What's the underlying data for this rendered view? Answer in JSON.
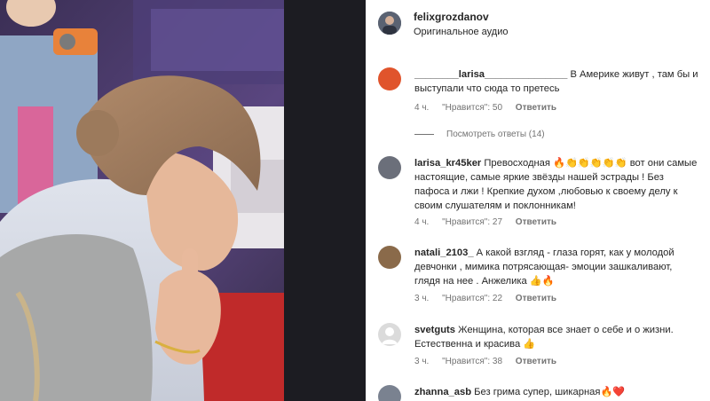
{
  "post": {
    "username": "felixgrozdanov",
    "audio": "Оригинальное аудио"
  },
  "comments": [
    {
      "username": "________larisa_______________",
      "text": "В Америке живут , там бы и выступали что сюда то претесь",
      "time": "4 ч.",
      "likes": "\"Нравится\": 50",
      "reply": "Ответить",
      "avatar_color": "#e0542c"
    },
    {
      "username": "larisa_kr45ker",
      "text": "Превосходная 🔥👏👏👏👏👏 вот они самые настоящие, самые яркие звёзды нашей эстрады ! Без пафоса и лжи ! Крепкие духом ,любовью к своему делу к своим слушателям и поклонникам!",
      "time": "4 ч.",
      "likes": "\"Нравится\": 27",
      "reply": "Ответить",
      "avatar_color": "#6b6f7a"
    },
    {
      "username": "natali_2103_",
      "text": "А какой взгляд - глаза горят, как у молодой девчонки , мимика потрясающая- эмоции зашкаливают, глядя на нее . Анжелика 👍🔥",
      "time": "3 ч.",
      "likes": "\"Нравится\": 22",
      "reply": "Ответить",
      "avatar_color": "#8a6a4a"
    },
    {
      "username": "svetguts",
      "text": "Женщина, которая все знает о себе и о жизни. Естественна и красива 👍",
      "time": "3 ч.",
      "likes": "\"Нравится\": 38",
      "reply": "Ответить",
      "avatar_color": "#dbdbdb"
    },
    {
      "username": "zhanna_asb",
      "text": "Без грима супер, шикарная🔥❤️",
      "avatar_color": "#7a8290"
    }
  ],
  "view_replies": "Посмотреть ответы (14)"
}
